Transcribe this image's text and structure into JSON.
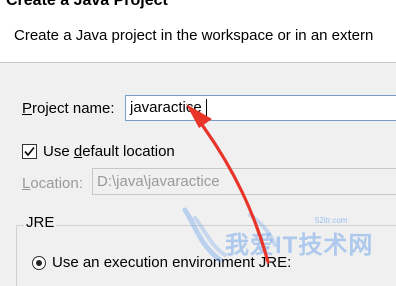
{
  "header": {
    "title": "Create a Java Project",
    "description": "Create a Java project in the workspace or in an extern"
  },
  "project_name": {
    "label_pre": "",
    "label_accel": "P",
    "label_post": "roject name:",
    "value": "javaractice"
  },
  "default_location": {
    "checked": true,
    "label_pre": "Use ",
    "label_accel": "d",
    "label_post": "efault location"
  },
  "location": {
    "label_accel": "L",
    "label_post": "ocation:",
    "value": "D:\\java\\javaractice"
  },
  "jre": {
    "group_label": "JRE",
    "option_label": "Use an execution environment JRE:"
  },
  "annotation": {
    "arrow_color": "#e8352a"
  },
  "watermark": {
    "text": "我爱IT技术网",
    "url": "52itr.com"
  }
}
